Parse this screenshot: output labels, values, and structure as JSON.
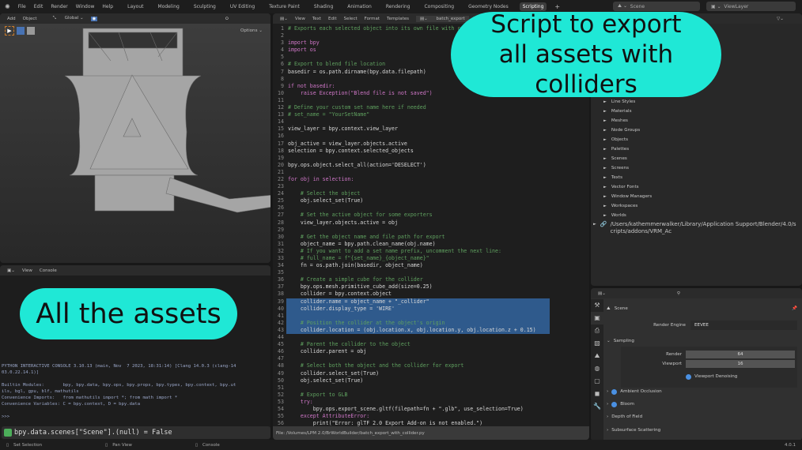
{
  "topbar": {
    "menus": [
      "File",
      "Edit",
      "Render",
      "Window",
      "Help"
    ],
    "workspaces": [
      "Layout",
      "Modeling",
      "Sculpting",
      "UV Editing",
      "Texture Paint",
      "Shading",
      "Animation",
      "Rendering",
      "Compositing",
      "Geometry Nodes",
      "Scripting"
    ],
    "active_workspace": "Scripting",
    "add_tab": "+",
    "scene": "Scene",
    "view_layer": "ViewLayer"
  },
  "viewport": {
    "menus": [
      "Add",
      "Object"
    ],
    "orientation": "Global",
    "options": "Options"
  },
  "text_editor": {
    "menus": [
      "View",
      "Text",
      "Edit",
      "Select",
      "Format",
      "Templates"
    ],
    "file_name": "batch_export",
    "footer": "File: /Volumes/LPM 2.0/BrWorldBuilder/batch_export_with_collider.py",
    "selected_lines": [
      39,
      40,
      41,
      42,
      43
    ],
    "lines": [
      "# Exports each selected object into its own file with colliders",
      "",
      "import bpy",
      "import os",
      "",
      "# Export to blend file location",
      "basedir = os.path.dirname(bpy.data.filepath)",
      "",
      "if not basedir:",
      "    raise Exception(\"Blend file is not saved\")",
      "",
      "# Define your custom set name here if needed",
      "# set_name = \"YourSetName\"",
      "",
      "view_layer = bpy.context.view_layer",
      "",
      "obj_active = view_layer.objects.active",
      "selection = bpy.context.selected_objects",
      "",
      "bpy.ops.object.select_all(action='DESELECT')",
      "",
      "for obj in selection:",
      "",
      "    # Select the object",
      "    obj.select_set(True)",
      "",
      "    # Set the active object for some exporters",
      "    view_layer.objects.active = obj",
      "",
      "    # Get the object name and file path for export",
      "    object_name = bpy.path.clean_name(obj.name)",
      "    # If you want to add a set name prefix, uncomment the next line:",
      "    # full_name = f\"{set_name}_{object_name}\"",
      "    fn = os.path.join(basedir, object_name)",
      "",
      "    # Create a simple cube for the collider",
      "    bpy.ops.mesh.primitive_cube_add(size=0.25)",
      "    collider = bpy.context.object",
      "    collider.name = object_name + \"_collider\"",
      "    collider.display_type = 'WIRE'",
      "",
      "    # Position the collider at the object's origin",
      "    collider.location = (obj.location.x, obj.location.y, obj.location.z + 0.15)",
      "",
      "    # Parent the collider to the object",
      "    collider.parent = obj",
      "",
      "    # Select both the object and the collider for export",
      "    collider.select_set(True)",
      "    obj.select_set(True)",
      "",
      "    # Export to GLB",
      "    try:",
      "        bpy.ops.export_scene.gltf(filepath=fn + \".glb\", use_selection=True)",
      "    except AttributeError:",
      "        print(\"Error: glTF 2.0 Export Add-on is not enabled.\")"
    ]
  },
  "console": {
    "menus": [
      "View",
      "Console"
    ],
    "output": "PYTHON INTERACTIVE CONSOLE 3.10.13 (main, Nov  7 2023, 18:31:14) [Clang 14.0.3 (clang-14\n03.0.22.14.1)]\n\nBuiltin Modules:       bpy, bpy.data, bpy.ops, bpy.props, bpy.types, bpy.context, bpy.ut\nils, bgl, gpu, blf, mathutils\nConvenience Imports:   from mathutils import *; from math import *\nConvenience Variables: C = bpy.context, D = bpy.data\n\n>>> ",
    "info_report": "bpy.data.scenes[\"Scene\"].(null) = False"
  },
  "outliner": {
    "items": [
      "Line Styles",
      "Materials",
      "Meshes",
      "Node Groups",
      "Objects",
      "Palettes",
      "Scenes",
      "Screens",
      "Texts",
      "Vector Fonts",
      "Window Managers",
      "Workspaces",
      "Worlds"
    ],
    "library_path": "/Users/kathemmerwalker/Library/Application Support/Blender/4.0/scripts/addons/VRM_Ac"
  },
  "properties": {
    "context": "Scene",
    "render_engine_label": "Render Engine",
    "render_engine": "EEVEE",
    "sampling": "Sampling",
    "render_label": "Render",
    "render_samples": "64",
    "viewport_label": "Viewport",
    "viewport_samples": "16",
    "viewport_denoising": "Viewport Denoising",
    "panels": [
      "Ambient Occlusion",
      "Bloom",
      "Depth of Field",
      "Subsurface Scattering"
    ]
  },
  "status": {
    "items": [
      "Set Selection",
      "Pan View",
      "Console"
    ],
    "version": "4.0.1"
  },
  "callouts": {
    "script": "Script to export all assets with colliders",
    "assets": "All the assets"
  },
  "colors": {
    "accent": "#1fe8d6",
    "selection": "#2f5a8c",
    "active_blue": "#4a90e2"
  }
}
